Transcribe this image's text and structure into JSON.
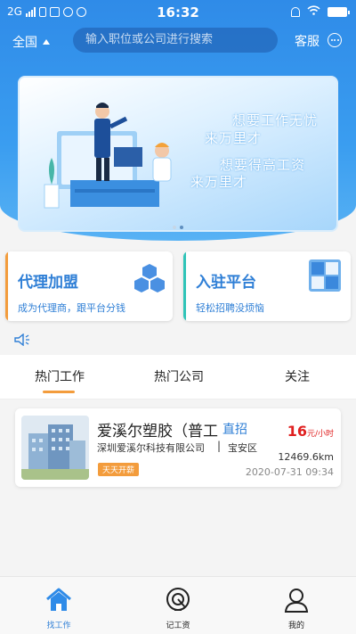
{
  "status_bar": {
    "network": "2G",
    "time": "16:32"
  },
  "top_bar": {
    "region": "全国",
    "search_placeholder": "输入职位或公司进行搜索",
    "service_label": "客服"
  },
  "banner": {
    "line1": "想要工作无忧",
    "line2": "来万里才",
    "line3": "想要得高工资",
    "line4": "来万里才",
    "page_count": 2,
    "active_page": 2
  },
  "cards": [
    {
      "title": "代理加盟",
      "subtitle": "成为代理商，跟平台分钱",
      "color": "#f39c3c",
      "title_color": "#2f7fd6"
    },
    {
      "title": "入驻平台",
      "subtitle": "轻松招聘没烦恼",
      "color": "#2fc4b8",
      "title_color": "#2f7fd6"
    }
  ],
  "tabs": {
    "items": [
      "热门工作",
      "热门公司",
      "关注"
    ],
    "active": "热门工作"
  },
  "job": {
    "title": "爱溪尔塑胶（普工",
    "tag": "直招",
    "salary": "16",
    "salary_unit": "元/小时",
    "company": "深圳爱溪尔科技有限公司",
    "separator": "|",
    "district": "宝安区",
    "badge": "天天开薪",
    "distance": "12469.6km",
    "posted": "2020-07-31 09:34"
  },
  "nav": {
    "items": [
      {
        "label": "找工作",
        "icon": "home-icon",
        "active": true
      },
      {
        "label": "记工资",
        "icon": "wage-record-icon",
        "active": false
      },
      {
        "label": "我的",
        "icon": "user-icon",
        "active": false
      }
    ]
  },
  "colors": {
    "brand_blue": "#2f8be8",
    "accent_orange": "#f39c3c",
    "salary_red": "#e02020"
  }
}
